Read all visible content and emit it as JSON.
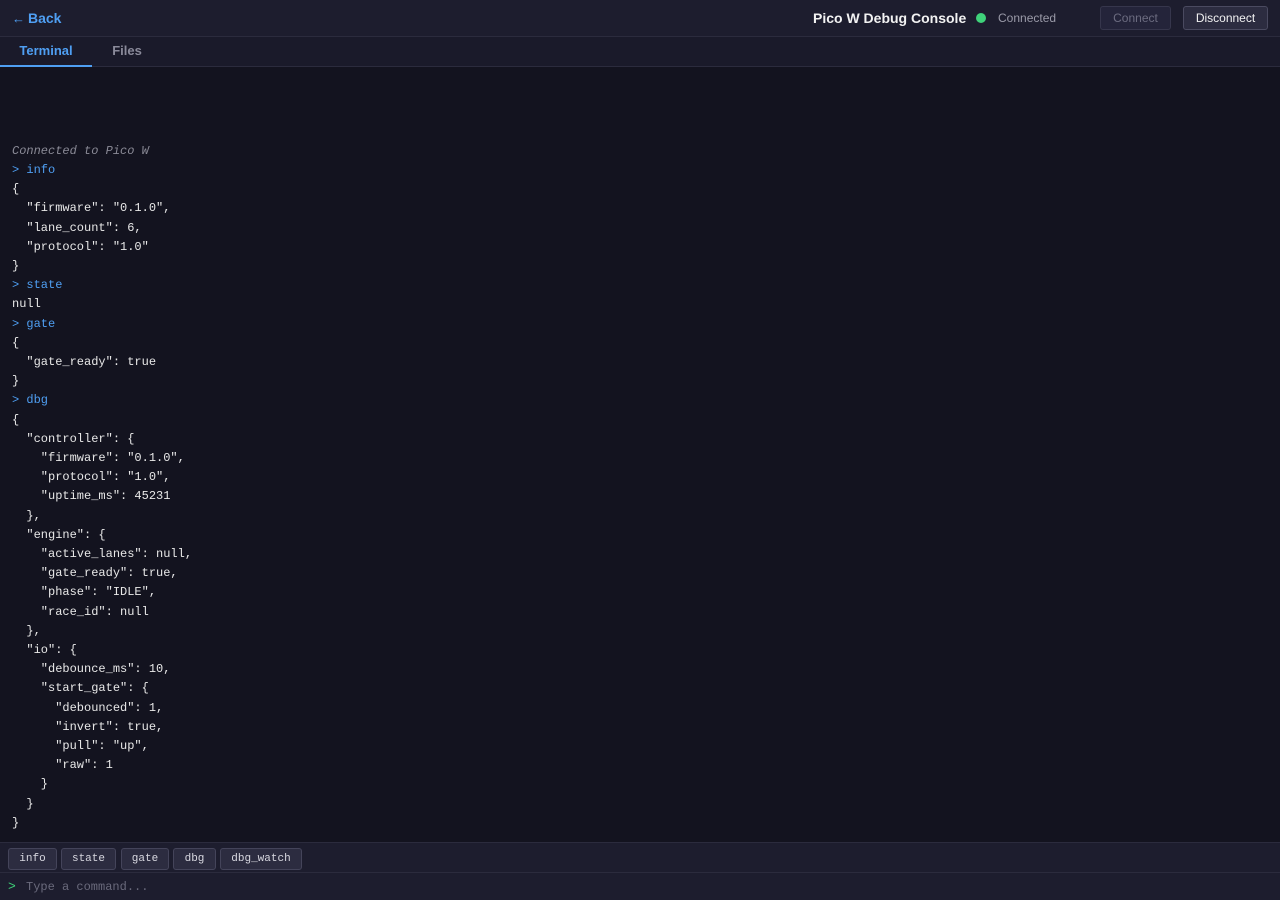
{
  "header": {
    "back_label": "Back",
    "title": "Pico W Debug Console",
    "status": "Connected",
    "status_color": "#3fd27a",
    "connect_label": "Connect",
    "disconnect_label": "Disconnect"
  },
  "tabs": [
    {
      "label": "Terminal",
      "active": true
    },
    {
      "label": "Files",
      "active": false
    }
  ],
  "terminal": {
    "lines": [
      {
        "type": "sys",
        "text": "Connected to Pico W"
      },
      {
        "type": "cmd",
        "text": "> info"
      },
      {
        "type": "out",
        "text": "{"
      },
      {
        "type": "out",
        "text": "  \"firmware\": \"0.1.0\","
      },
      {
        "type": "out",
        "text": "  \"lane_count\": 6,"
      },
      {
        "type": "out",
        "text": "  \"protocol\": \"1.0\""
      },
      {
        "type": "out",
        "text": "}"
      },
      {
        "type": "cmd",
        "text": "> state"
      },
      {
        "type": "out",
        "text": "null"
      },
      {
        "type": "cmd",
        "text": "> gate"
      },
      {
        "type": "out",
        "text": "{"
      },
      {
        "type": "out",
        "text": "  \"gate_ready\": true"
      },
      {
        "type": "out",
        "text": "}"
      },
      {
        "type": "cmd",
        "text": "> dbg"
      },
      {
        "type": "out",
        "text": "{"
      },
      {
        "type": "out",
        "text": "  \"controller\": {"
      },
      {
        "type": "out",
        "text": "    \"firmware\": \"0.1.0\","
      },
      {
        "type": "out",
        "text": "    \"protocol\": \"1.0\","
      },
      {
        "type": "out",
        "text": "    \"uptime_ms\": 45231"
      },
      {
        "type": "out",
        "text": "  },"
      },
      {
        "type": "out",
        "text": "  \"engine\": {"
      },
      {
        "type": "out",
        "text": "    \"active_lanes\": null,"
      },
      {
        "type": "out",
        "text": "    \"gate_ready\": true,"
      },
      {
        "type": "out",
        "text": "    \"phase\": \"IDLE\","
      },
      {
        "type": "out",
        "text": "    \"race_id\": null"
      },
      {
        "type": "out",
        "text": "  },"
      },
      {
        "type": "out",
        "text": "  \"io\": {"
      },
      {
        "type": "out",
        "text": "    \"debounce_ms\": 10,"
      },
      {
        "type": "out",
        "text": "    \"start_gate\": {"
      },
      {
        "type": "out",
        "text": "      \"debounced\": 1,"
      },
      {
        "type": "out",
        "text": "      \"invert\": true,"
      },
      {
        "type": "out",
        "text": "      \"pull\": \"up\","
      },
      {
        "type": "out",
        "text": "      \"raw\": 1"
      },
      {
        "type": "out",
        "text": "    }"
      },
      {
        "type": "out",
        "text": "  }"
      },
      {
        "type": "out",
        "text": "}"
      }
    ]
  },
  "quick_commands": [
    "info",
    "state",
    "gate",
    "dbg",
    "dbg_watch"
  ],
  "input": {
    "prompt": ">",
    "placeholder": "Type a command..."
  }
}
